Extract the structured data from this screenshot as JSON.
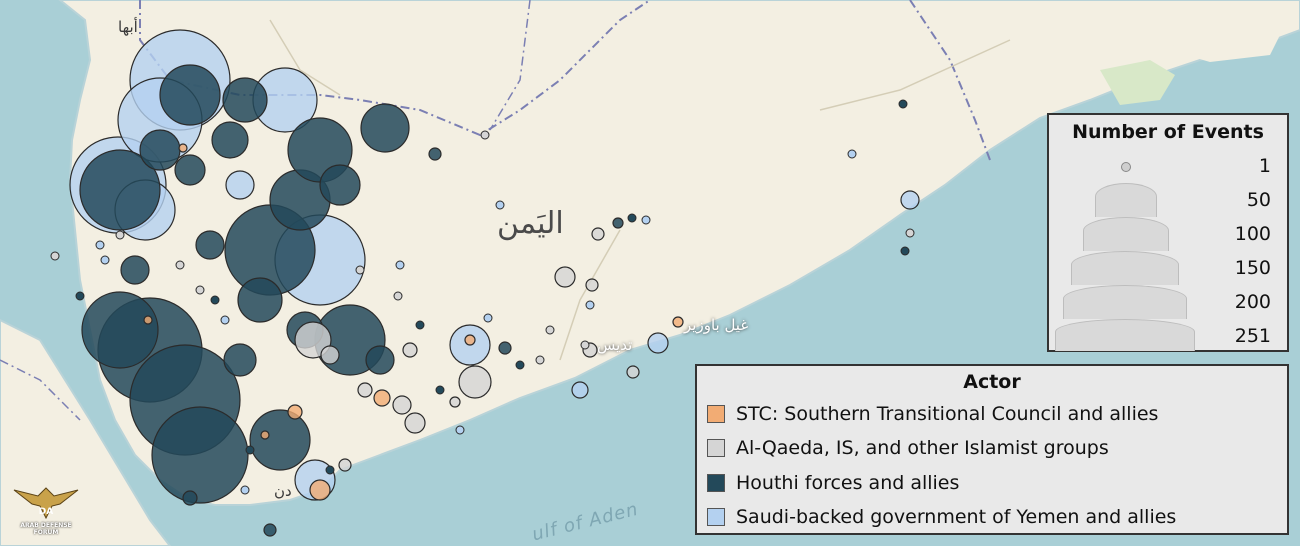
{
  "places": {
    "abha": "أبها",
    "yemen": "اليَمن",
    "ghayl_bawazir": "غيل باوزير",
    "ataq_partial": "تديس",
    "aden_partial": "دن",
    "gulf_partial": "ulf of Aden"
  },
  "legend_size": {
    "title": "Number of Events",
    "items": [
      "1",
      "50",
      "100",
      "150",
      "200",
      "251"
    ]
  },
  "legend_actor": {
    "title": "Actor",
    "items": [
      {
        "label": "STC: Southern Transitional Council and allies",
        "color": "#f2ac74"
      },
      {
        "label": "Al-Qaeda, IS, and other Islamist groups",
        "color": "#d5d5d5"
      },
      {
        "label": "Houthi forces and allies",
        "color": "#23495a"
      },
      {
        "label": "Saudi-backed government of Yemen and allies",
        "color": "#b4d1f0"
      }
    ]
  },
  "watermark": {
    "initials": "DA",
    "name": "ARAB DEFENSE FORUM"
  },
  "colors": {
    "sea": "#a9cfd6",
    "land": "#f3efe2",
    "houthi": "#23495a",
    "saudi": "#b4d1f0",
    "islamist": "#d5d5d5",
    "stc": "#f2ac74"
  }
}
